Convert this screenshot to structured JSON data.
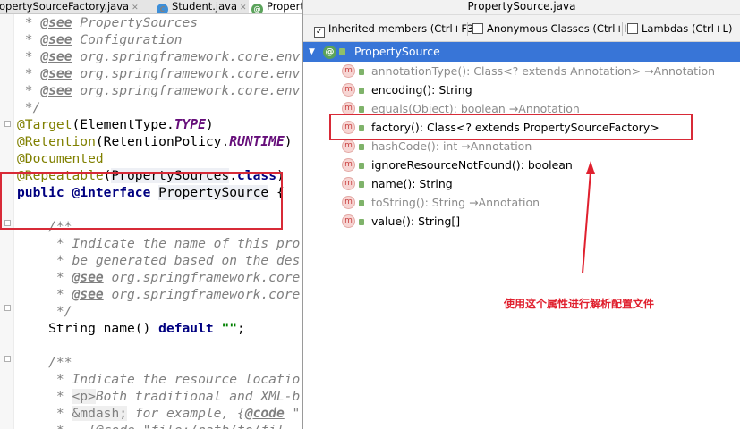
{
  "editor": {
    "tabs": [
      {
        "label": "opertySourceFactory.java",
        "icon": "class-icon",
        "active": false
      },
      {
        "label": "Student.java",
        "icon": "class-icon",
        "active": false
      },
      {
        "label": "PropertySource.java",
        "icon": "annotation-icon",
        "active": true
      }
    ],
    "lines": [
      {
        "segments": [
          {
            "t": " * ",
            "s": "c"
          },
          {
            "t": "@see",
            "s": "tag"
          },
          {
            "t": " PropertySources",
            "s": "c"
          }
        ]
      },
      {
        "segments": [
          {
            "t": " * ",
            "s": "c"
          },
          {
            "t": "@see",
            "s": "tag"
          },
          {
            "t": " Configuration",
            "s": "c"
          }
        ]
      },
      {
        "segments": [
          {
            "t": " * ",
            "s": "c"
          },
          {
            "t": "@see",
            "s": "tag"
          },
          {
            "t": " org.springframework.core.env",
            "s": "c"
          }
        ]
      },
      {
        "segments": [
          {
            "t": " * ",
            "s": "c"
          },
          {
            "t": "@see",
            "s": "tag"
          },
          {
            "t": " org.springframework.core.env",
            "s": "c"
          }
        ]
      },
      {
        "segments": [
          {
            "t": " * ",
            "s": "c"
          },
          {
            "t": "@see",
            "s": "tag"
          },
          {
            "t": " org.springframework.core.env",
            "s": "c"
          }
        ]
      },
      {
        "segments": [
          {
            "t": " */",
            "s": "c"
          }
        ]
      },
      {
        "segments": [
          {
            "t": "@Target",
            "s": "ann"
          },
          {
            "t": "(ElementType.",
            "s": ""
          },
          {
            "t": "TYPE",
            "s": "cst"
          },
          {
            "t": ")",
            "s": ""
          }
        ]
      },
      {
        "segments": [
          {
            "t": "@Retention",
            "s": "ann"
          },
          {
            "t": "(RetentionPolicy.",
            "s": ""
          },
          {
            "t": "RUNTIME",
            "s": "cst"
          },
          {
            "t": ")",
            "s": ""
          }
        ]
      },
      {
        "segments": [
          {
            "t": "@Documented",
            "s": "ann"
          }
        ]
      },
      {
        "segments": [
          {
            "t": "@Repeatable",
            "s": "ann"
          },
          {
            "t": "(",
            "s": ""
          },
          {
            "t": "PropertySources",
            "s": "hl"
          },
          {
            "t": ".",
            "s": ""
          },
          {
            "t": "class",
            "s": "kw"
          },
          {
            "t": ")",
            "s": ""
          }
        ]
      },
      {
        "segments": [
          {
            "t": "public ",
            "s": "kw"
          },
          {
            "t": "@interface ",
            "s": "kw"
          },
          {
            "t": "PropertySource",
            "s": "hl"
          },
          {
            "t": " {",
            "s": ""
          }
        ]
      },
      {
        "segments": []
      },
      {
        "segments": [
          {
            "t": "    /**",
            "s": "c"
          }
        ]
      },
      {
        "segments": [
          {
            "t": "     * Indicate the name of this pro",
            "s": "c"
          }
        ]
      },
      {
        "segments": [
          {
            "t": "     * be generated based on the des",
            "s": "c"
          }
        ]
      },
      {
        "segments": [
          {
            "t": "     * ",
            "s": "c"
          },
          {
            "t": "@see",
            "s": "tag"
          },
          {
            "t": " org.springframework.core",
            "s": "c"
          }
        ]
      },
      {
        "segments": [
          {
            "t": "     * ",
            "s": "c"
          },
          {
            "t": "@see",
            "s": "tag"
          },
          {
            "t": " org.springframework.core",
            "s": "c"
          }
        ]
      },
      {
        "segments": [
          {
            "t": "     */",
            "s": "c"
          }
        ]
      },
      {
        "segments": [
          {
            "t": "    String name() ",
            "s": ""
          },
          {
            "t": "default",
            "s": "kw"
          },
          {
            "t": " ",
            "s": ""
          },
          {
            "t": "\"\"",
            "s": "str"
          },
          {
            "t": ";",
            "s": ""
          }
        ]
      },
      {
        "segments": []
      },
      {
        "segments": [
          {
            "t": "    /**",
            "s": "c"
          }
        ]
      },
      {
        "segments": [
          {
            "t": "     * Indicate the resource locatio",
            "s": "c"
          }
        ]
      },
      {
        "segments": [
          {
            "t": "     * ",
            "s": "c"
          },
          {
            "t": "<p>",
            "s": "html-tag"
          },
          {
            "t": "Both traditional and XML-b",
            "s": "c"
          }
        ]
      },
      {
        "segments": [
          {
            "t": "     * ",
            "s": "c"
          },
          {
            "t": "&mdash;",
            "s": "html-tag"
          },
          {
            "t": " for example, {",
            "s": "c"
          },
          {
            "t": "@code",
            "s": "tag"
          },
          {
            "t": " \"",
            "s": "c"
          }
        ]
      },
      {
        "segments": [
          {
            "t": "     *   {@code \"file:/path/to/fil",
            "s": "c"
          }
        ]
      }
    ]
  },
  "popup": {
    "title": "PropertySource.java",
    "filters": [
      {
        "label": "Inherited members (Ctrl+F3)",
        "checked": true
      },
      {
        "label": "Anonymous Classes (Ctrl+I)",
        "checked": false
      },
      {
        "label": "Lambdas (Ctrl+L)",
        "checked": false
      }
    ],
    "root": {
      "label": "PropertySource",
      "icon": "annotation-type-icon"
    },
    "members": [
      {
        "label": "annotationType(): Class<? extends Annotation> →Annotation",
        "inherited": true,
        "icon": "method-icon"
      },
      {
        "label": "encoding(): String",
        "inherited": false,
        "icon": "method-icon"
      },
      {
        "label": "equals(Object): boolean →Annotation",
        "inherited": true,
        "icon": "method-icon"
      },
      {
        "label": "factory(): Class<? extends PropertySourceFactory>",
        "inherited": false,
        "icon": "method-icon"
      },
      {
        "label": "hashCode(): int →Annotation",
        "inherited": true,
        "icon": "method-icon"
      },
      {
        "label": "ignoreResourceNotFound(): boolean",
        "inherited": false,
        "icon": "method-icon"
      },
      {
        "label": "name(): String",
        "inherited": false,
        "icon": "method-icon"
      },
      {
        "label": "toString(): String →Annotation",
        "inherited": true,
        "icon": "method-icon"
      },
      {
        "label": "value(): String[]",
        "inherited": false,
        "icon": "method-icon"
      }
    ],
    "method_icon_letter": "m",
    "root_icon_letter": "@"
  },
  "annotation": {
    "text": "使用这个属性进行解析配置文件",
    "color": "#e0202e"
  },
  "colors": {
    "selection": "#3875d7",
    "highlight_box": "#d82a37"
  }
}
